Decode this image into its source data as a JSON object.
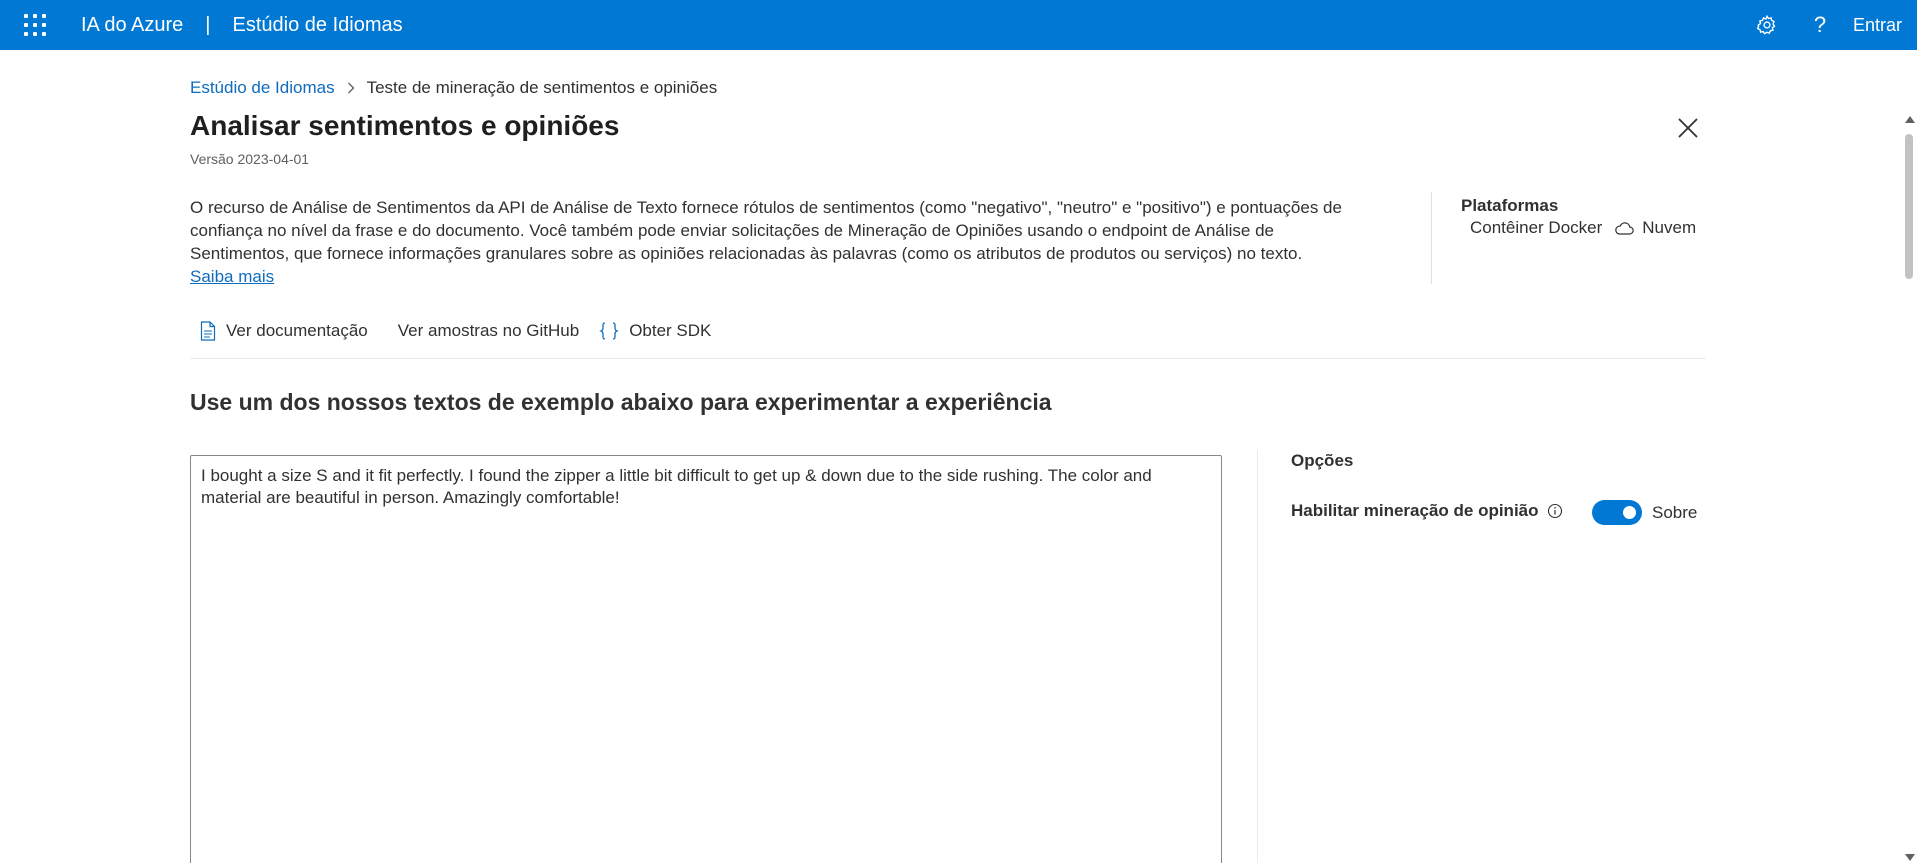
{
  "header": {
    "app_name": "IA do Azure",
    "separator": "|",
    "product_name": "Estúdio de Idiomas",
    "help_glyph": "?",
    "signin_label": "Entrar",
    "icons": [
      "app-launcher-icon",
      "gear-icon",
      "help-icon"
    ],
    "background_color": "#0078d4"
  },
  "breadcrumb": {
    "root": "Estúdio de Idiomas",
    "current": "Teste de mineração de sentimentos e opiniões"
  },
  "page": {
    "title": "Analisar sentimentos e opiniões",
    "version": "Versão 2023-04-01",
    "description": "O recurso de Análise de Sentimentos da API de Análise de Texto fornece rótulos de sentimentos (como \"negativo\", \"neutro\" e \"positivo\") e pontuações de confiança no nível da frase e do documento. Você também pode enviar solicitações de Mineração de Opiniões usando o endpoint de Análise de Sentimentos, que fornece informações granulares sobre as opiniões relacionadas às palavras (como os atributos de produtos ou serviços) no texto.",
    "learn_more": "Saiba mais"
  },
  "platforms": {
    "title": "Plataformas",
    "docker": "Contêiner Docker",
    "cloud": "Nuvem"
  },
  "links": {
    "docs": "Ver documentação",
    "github": "Ver amostras no GitHub",
    "sdk": "Obter SDK"
  },
  "try_section": {
    "title": "Use um dos nossos textos de exemplo abaixo para experimentar a experiência",
    "sample_text": "I bought a size S and it fit perfectly. I found the zipper a little bit difficult to get up & down due to the side rushing. The color and material are beautiful in person. Amazingly comfortable!"
  },
  "options": {
    "title": "Opções",
    "opinion_mining_label": "Habilitar mineração de opinião",
    "opinion_mining_enabled": true,
    "toggle_state_label": "Sobre"
  },
  "colors": {
    "accent": "#0078d4",
    "link": "#0f6cbd",
    "text": "#323130"
  }
}
